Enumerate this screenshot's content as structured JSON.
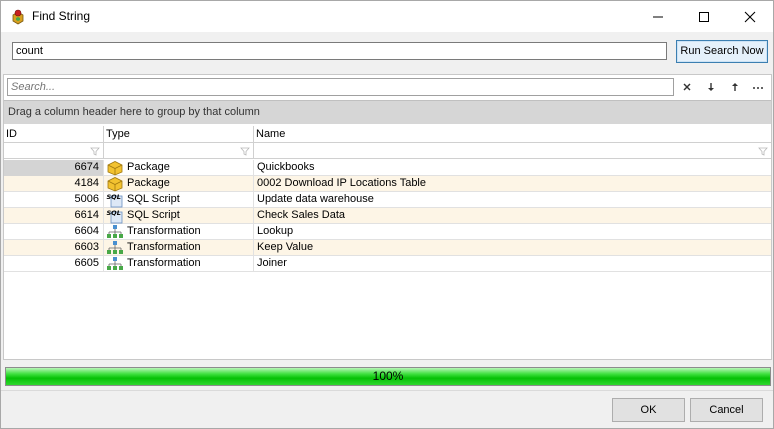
{
  "window": {
    "title": "Find String"
  },
  "search": {
    "value": "count",
    "run_label": "Run Search Now"
  },
  "grid": {
    "find_placeholder": "Search...",
    "group_hint": "Drag a column header here to group by that column",
    "columns": [
      "ID",
      "Type",
      "Name"
    ],
    "rows": [
      {
        "id": "6674",
        "type": "Package",
        "icon": "package-icon",
        "name": "Quickbooks"
      },
      {
        "id": "4184",
        "type": "Package",
        "icon": "package-icon",
        "name": "0002 Download IP Locations Table"
      },
      {
        "id": "5006",
        "type": "SQL Script",
        "icon": "sql-script-icon",
        "name": "Update data warehouse"
      },
      {
        "id": "6614",
        "type": "SQL Script",
        "icon": "sql-script-icon",
        "name": "Check Sales Data"
      },
      {
        "id": "6604",
        "type": "Transformation",
        "icon": "transformation-icon",
        "name": "Lookup"
      },
      {
        "id": "6603",
        "type": "Transformation",
        "icon": "transformation-icon",
        "name": "Keep Value"
      },
      {
        "id": "6605",
        "type": "Transformation",
        "icon": "transformation-icon",
        "name": "Joiner"
      }
    ]
  },
  "progress": {
    "value": 1.0,
    "label": "100%"
  },
  "buttons": {
    "ok": "OK",
    "cancel": "Cancel"
  },
  "colors": {
    "accent": "#3c7fb1",
    "progress": "#06c106",
    "alt_row": "#fdf5e6"
  }
}
